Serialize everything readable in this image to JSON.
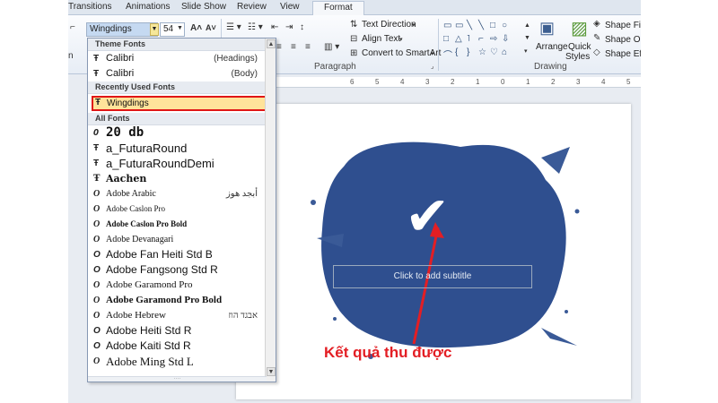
{
  "ribbon_tabs": [
    "Transitions",
    "Animations",
    "Slide Show",
    "Review",
    "View",
    "Format"
  ],
  "font_name": "Wingdings",
  "font_size": "54",
  "paragraph_group": {
    "text_direction": "Text Direction",
    "align_text": "Align Text",
    "convert_smartart": "Convert to SmartArt",
    "label": "Paragraph"
  },
  "drawing_group": {
    "arrange": "Arrange",
    "quick_styles_1": "Quick",
    "quick_styles_2": "Styles",
    "shape_fill": "Shape Fill",
    "shape_outline": "Shape Ou",
    "shape_effects": "Shape Eff",
    "label": "Drawing"
  },
  "ruler_marks": [
    "6",
    "5",
    "4",
    "3",
    "2",
    "1",
    "0",
    "1",
    "2",
    "3",
    "4",
    "5"
  ],
  "dropdown": {
    "theme_header": "Theme Fonts",
    "theme_fonts": [
      {
        "name": "Calibri",
        "note": "(Headings)"
      },
      {
        "name": "Calibri",
        "note": "(Body)"
      }
    ],
    "recent_header": "Recently Used Fonts",
    "recent_font": "Wingdings",
    "all_header": "All Fonts",
    "all_fonts": [
      {
        "name": "20 db",
        "right": ""
      },
      {
        "name": "a_FuturaRound",
        "right": ""
      },
      {
        "name": "a_FuturaRoundDemi",
        "right": ""
      },
      {
        "name": "Aachen",
        "right": ""
      },
      {
        "name": "Adobe Arabic",
        "right": "أبجد هوز"
      },
      {
        "name": "Adobe Caslon Pro",
        "right": ""
      },
      {
        "name": "Adobe Caslon Pro Bold",
        "right": ""
      },
      {
        "name": "Adobe Devanagari",
        "right": ""
      },
      {
        "name": "Adobe Fan Heiti Std B",
        "right": ""
      },
      {
        "name": "Adobe Fangsong Std R",
        "right": ""
      },
      {
        "name": "Adobe Garamond Pro",
        "right": ""
      },
      {
        "name": "Adobe Garamond Pro Bold",
        "right": ""
      },
      {
        "name": "Adobe Hebrew",
        "right": "אבגד הוז"
      },
      {
        "name": "Adobe Heiti Std R",
        "right": ""
      },
      {
        "name": "Adobe Kaiti Std R",
        "right": ""
      },
      {
        "name": "Adobe Ming Std L",
        "right": ""
      }
    ]
  },
  "slide": {
    "checkmark": "✔",
    "subtitle_placeholder": "Click to add subtitle",
    "caption": "Kết quả thu được",
    "brush_color": "#2f4f8f"
  },
  "colors": {
    "highlight_border": "#e01616",
    "highlight_fill": "#ffe39a",
    "caption_red": "#e31e24"
  }
}
